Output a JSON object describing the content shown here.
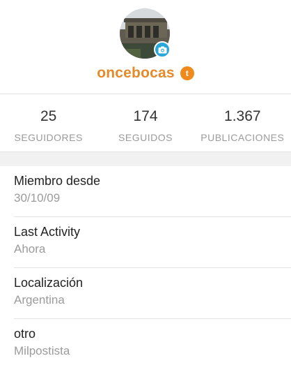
{
  "profile": {
    "username": "oncebocas",
    "avatar_icon": "building-photo",
    "camera_icon": "camera-icon",
    "badge_icon": "ticket-icon",
    "accent_color": "#e48a2b"
  },
  "stats": [
    {
      "value": "25",
      "label": "SEGUIDORES"
    },
    {
      "value": "174",
      "label": "SEGUIDOS"
    },
    {
      "value": "1.367",
      "label": "PUBLICACIONES"
    }
  ],
  "info": [
    {
      "title": "Miembro desde",
      "value": "30/10/09"
    },
    {
      "title": "Last Activity",
      "value": "Ahora"
    },
    {
      "title": "Localización",
      "value": "Argentina"
    },
    {
      "title": "otro",
      "value": "Milpostista"
    }
  ]
}
